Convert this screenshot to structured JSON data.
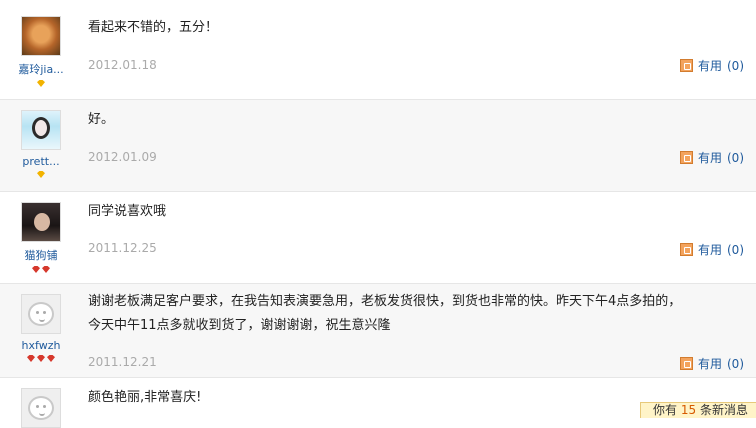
{
  "reviews": [
    {
      "username": "嘉玲jia...",
      "content": "看起来不错的，五分！",
      "date": "2012.01.18",
      "useful_label": "有用",
      "useful_count": "(0)"
    },
    {
      "username": "prett...",
      "content": "好。",
      "date": "2012.01.09",
      "useful_label": "有用",
      "useful_count": "(0)"
    },
    {
      "username": "猫狗铺",
      "content": "同学说喜欢哦",
      "date": "2011.12.25",
      "useful_label": "有用",
      "useful_count": "(0)"
    },
    {
      "username": "hxfwzh",
      "content_line1": "谢谢老板满足客户要求，在我告知表演要急用，老板发货很快，到货也非常的快。昨天下午4点多拍的，",
      "content_line2": "今天中午11点多就收到货了，谢谢谢谢，祝生意兴隆",
      "date": "2011.12.21",
      "useful_label": "有用",
      "useful_count": "(0)"
    },
    {
      "content": "颜色艳丽,非常喜庆!"
    }
  ],
  "notice": {
    "prefix": "你有",
    "count": "15",
    "suffix": "条新消息"
  }
}
